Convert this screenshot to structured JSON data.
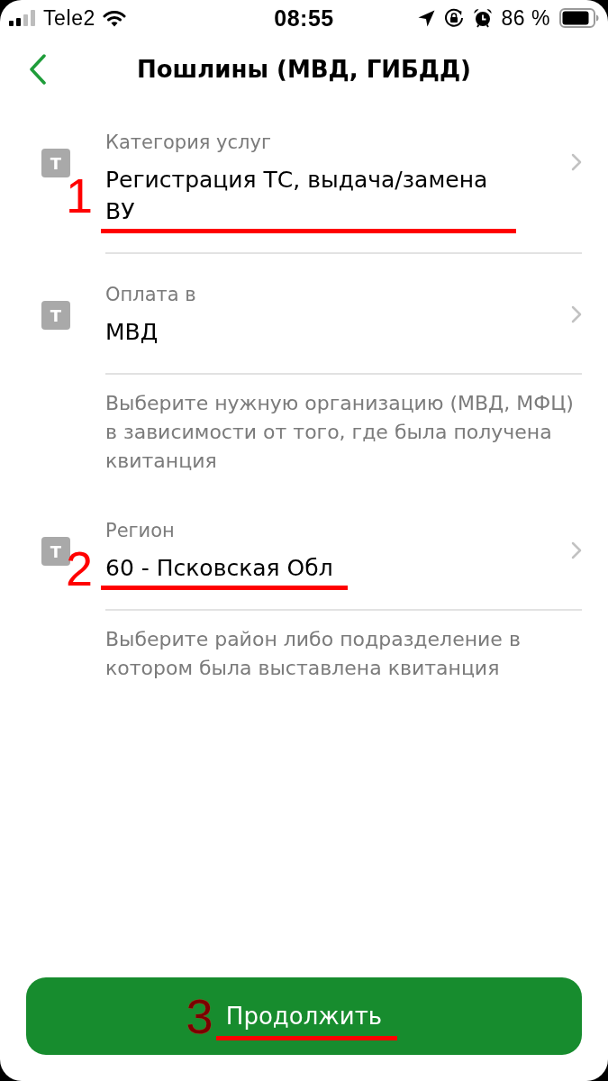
{
  "status_bar": {
    "carrier": "Tele2",
    "time": "08:55",
    "battery": "86 %"
  },
  "header": {
    "title": "Пошлины (МВД, ГИБДД)"
  },
  "fields": [
    {
      "badge": "T",
      "label": "Категория услуг",
      "value": "Регистрация ТС, выдача/замена ВУ",
      "annotation": "1"
    },
    {
      "badge": "T",
      "label": "Оплата в",
      "value": "МВД",
      "hint": "Выберите нужную организацию (МВД, МФЦ) в зависимости от того, где была получена квитанция"
    },
    {
      "badge": "T",
      "label": "Регион",
      "value": "60 - Псковская Обл",
      "annotation": "2",
      "hint": "Выберите район либо подразделение в котором была выставлена квитанция"
    }
  ],
  "continue_button": {
    "label": "Продолжить",
    "annotation": "3"
  }
}
